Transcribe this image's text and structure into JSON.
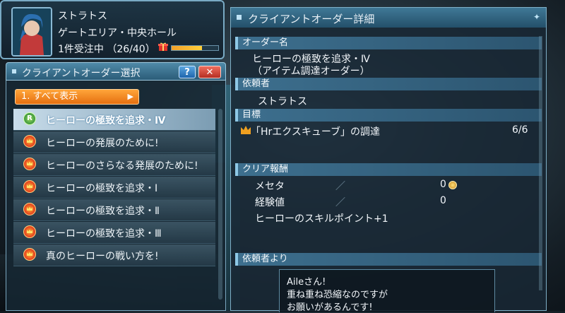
{
  "player": {
    "name": "ストラトス",
    "location": "ゲートエリア・中央ホール",
    "orders_status": "1件受注中 （26/40）",
    "orders_count": 26,
    "orders_max": 40
  },
  "selection_panel": {
    "title": "クライアントオーダー選択",
    "help_label": "?",
    "close_label": "✕",
    "filter_tab": "1. すべて表示",
    "orders": [
      {
        "label": "ヒーローの極致を追求・Ⅳ",
        "icon": "r-badge-icon",
        "badge": "R",
        "selected": true
      },
      {
        "label": "ヒーローの発展のために!",
        "icon": "crown-icon",
        "selected": false
      },
      {
        "label": "ヒーローのさらなる発展のために!",
        "icon": "crown-icon",
        "selected": false
      },
      {
        "label": "ヒーローの極致を追求・Ⅰ",
        "icon": "crown-icon",
        "selected": false
      },
      {
        "label": "ヒーローの極致を追求・Ⅱ",
        "icon": "crown-icon",
        "selected": false
      },
      {
        "label": "ヒーローの極致を追求・Ⅲ",
        "icon": "crown-icon",
        "selected": false
      },
      {
        "label": "真のヒーローの戦い方を!",
        "icon": "crown-icon",
        "selected": false
      }
    ]
  },
  "detail_panel": {
    "title": "クライアントオーダー詳細",
    "order_name_header": "オーダー名",
    "order_name_line1": "ヒーローの極致を追求・Ⅳ",
    "order_name_line2": "（アイテム調達オーダー）",
    "client_header": "依頼者",
    "client_name": "ストラトス",
    "target_header": "目標",
    "target_text": "「Hrエクスキューブ」の調達",
    "target_progress": "6/6",
    "reward_header": "クリア報酬",
    "rewards": [
      {
        "label": "メセタ",
        "sep": "／",
        "value": "0"
      },
      {
        "label": "経験値",
        "sep": "／",
        "value": "0"
      }
    ],
    "reward_extra": "ヒーローのスキルポイント+1",
    "message_header": "依頼者より",
    "message_lines": [
      "Aileさん!",
      "重ね重ね恐縮なのですが",
      "お願いがあるんです!"
    ]
  },
  "colors": {
    "accent_orange": "#e56f10",
    "panel_blue": "#3f7896",
    "close_red": "#b52e22"
  }
}
